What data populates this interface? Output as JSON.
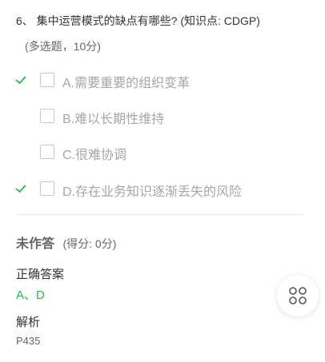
{
  "question": {
    "title": "6、 集中运营模式的缺点有哪些?",
    "knowledge_point": "(知识点: CDGP)",
    "meta": "(多选题，10分)"
  },
  "options": [
    {
      "text": "A.需要重要的组织变革",
      "correct_mark": true
    },
    {
      "text": "B.难以长期性维持",
      "correct_mark": false
    },
    {
      "text": "C.很难协调",
      "correct_mark": false
    },
    {
      "text": "D.存在业务知识逐渐丢失的风险",
      "correct_mark": true
    }
  ],
  "status": {
    "label": "未作答",
    "score": "(得分: 0分)"
  },
  "answer": {
    "heading": "正确答案",
    "value": "A、D"
  },
  "explanation": {
    "heading": "解析",
    "value": "P435"
  },
  "colors": {
    "correct": "#2bb24c",
    "muted_text": "#a6a6a6"
  },
  "icons": {
    "check": "check-icon",
    "float": "grid-menu-icon"
  }
}
